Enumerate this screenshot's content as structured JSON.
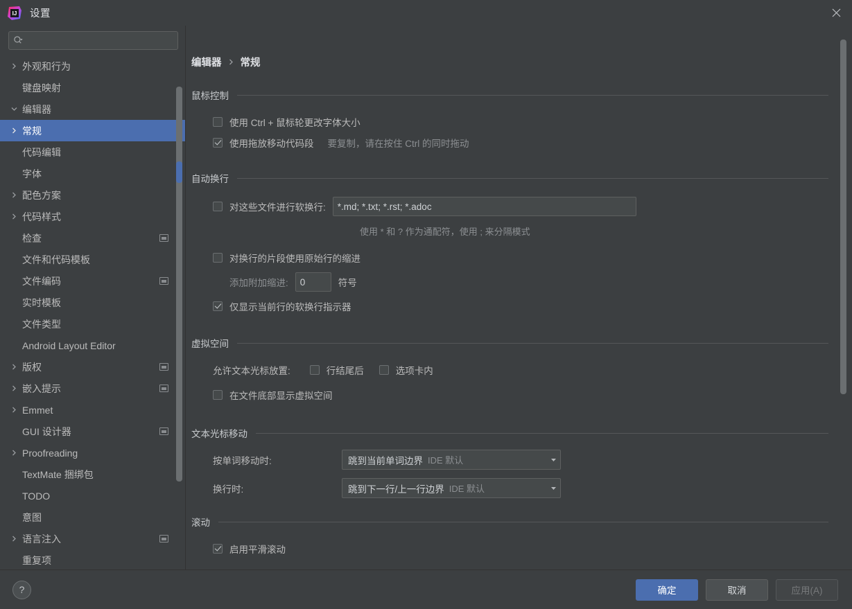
{
  "window": {
    "title": "设置",
    "app_icon": "intellij-idea-logo",
    "close_icon": "close-icon"
  },
  "sidebar": {
    "search": {
      "placeholder": "",
      "value": "",
      "icon": "search-icon"
    },
    "items": [
      {
        "label": "外观和行为",
        "level": 0,
        "arrow": "chevron-right",
        "badge": false,
        "selected": false
      },
      {
        "label": "键盘映射",
        "level": 0,
        "arrow": "",
        "badge": false,
        "selected": false
      },
      {
        "label": "编辑器",
        "level": 0,
        "arrow": "chevron-down",
        "badge": false,
        "selected": false
      },
      {
        "label": "常规",
        "level": 1,
        "arrow": "chevron-right",
        "badge": false,
        "selected": true
      },
      {
        "label": "代码编辑",
        "level": 1,
        "arrow": "",
        "badge": false,
        "selected": false
      },
      {
        "label": "字体",
        "level": 1,
        "arrow": "",
        "badge": false,
        "selected": false
      },
      {
        "label": "配色方案",
        "level": 1,
        "arrow": "chevron-right",
        "badge": false,
        "selected": false
      },
      {
        "label": "代码样式",
        "level": 1,
        "arrow": "chevron-right",
        "badge": false,
        "selected": false
      },
      {
        "label": "检查",
        "level": 1,
        "arrow": "",
        "badge": true,
        "selected": false
      },
      {
        "label": "文件和代码模板",
        "level": 1,
        "arrow": "",
        "badge": false,
        "selected": false
      },
      {
        "label": "文件编码",
        "level": 1,
        "arrow": "",
        "badge": true,
        "selected": false
      },
      {
        "label": "实时模板",
        "level": 1,
        "arrow": "",
        "badge": false,
        "selected": false
      },
      {
        "label": "文件类型",
        "level": 1,
        "arrow": "",
        "badge": false,
        "selected": false
      },
      {
        "label": "Android Layout Editor",
        "level": 1,
        "arrow": "",
        "badge": false,
        "selected": false
      },
      {
        "label": "版权",
        "level": 1,
        "arrow": "chevron-right",
        "badge": true,
        "selected": false
      },
      {
        "label": "嵌入提示",
        "level": 1,
        "arrow": "chevron-right",
        "badge": true,
        "selected": false
      },
      {
        "label": "Emmet",
        "level": 1,
        "arrow": "chevron-right",
        "badge": false,
        "selected": false
      },
      {
        "label": "GUI 设计器",
        "level": 1,
        "arrow": "",
        "badge": true,
        "selected": false
      },
      {
        "label": "Proofreading",
        "level": 1,
        "arrow": "chevron-right",
        "badge": false,
        "selected": false
      },
      {
        "label": "TextMate 捆绑包",
        "level": 1,
        "arrow": "",
        "badge": false,
        "selected": false
      },
      {
        "label": "TODO",
        "level": 1,
        "arrow": "",
        "badge": false,
        "selected": false
      },
      {
        "label": "意图",
        "level": 1,
        "arrow": "",
        "badge": false,
        "selected": false
      },
      {
        "label": "语言注入",
        "level": 1,
        "arrow": "chevron-right",
        "badge": true,
        "selected": false
      },
      {
        "label": "重复项",
        "level": 1,
        "arrow": "",
        "badge": false,
        "selected": false
      }
    ]
  },
  "breadcrumb": {
    "parent": "编辑器",
    "current": "常规",
    "separator_icon": "chevron-right-icon"
  },
  "sections": {
    "mouse": {
      "title": "鼠标控制",
      "ctrl_wheel": {
        "label": "使用 Ctrl + 鼠标轮更改字体大小",
        "checked": false
      },
      "drag_drop": {
        "label": "使用拖放移动代码段",
        "hint": "要复制，请在按住 Ctrl 的同时拖动",
        "checked": true
      }
    },
    "soft_wrap": {
      "title": "自动换行",
      "files_label": "对这些文件进行软换行:",
      "files_checked": false,
      "files_value": "*.md; *.txt; *.rst; *.adoc",
      "hint": "使用 * 和 ? 作为通配符，使用 ; 来分隔模式",
      "original_indent": {
        "label": "对换行的片段使用原始行的缩进",
        "checked": false
      },
      "additional_indent_label": "添加附加缩进:",
      "additional_indent_value": "0",
      "additional_indent_unit": "符号",
      "current_line_only": {
        "label": "仅显示当前行的软换行指示器",
        "checked": true
      }
    },
    "virtual_space": {
      "title": "虚拟空间",
      "allow_label": "允许文本光标放置:",
      "after_line_end": {
        "label": "行结尾后",
        "checked": false
      },
      "inside_tabs": {
        "label": "选项卡内",
        "checked": false
      },
      "show_bottom": {
        "label": "在文件底部显示虚拟空间",
        "checked": false
      }
    },
    "caret": {
      "title": "文本光标移动",
      "word_move_label": "按单词移动时:",
      "word_move_value": "跳到当前单词边界",
      "word_move_default": "IDE 默认",
      "line_wrap_label": "换行时:",
      "line_wrap_value": "跳到下一行/上一行边界",
      "line_wrap_default": "IDE 默认",
      "dropdown_icon": "chevron-down-icon"
    },
    "scrolling": {
      "title": "滚动",
      "smooth": {
        "label": "启用平滑滚动",
        "checked": true
      }
    }
  },
  "footer": {
    "help_label": "?",
    "ok": "确定",
    "cancel": "取消",
    "apply": "应用(A)"
  },
  "colors": {
    "background": "#3c3f41",
    "accent": "#4b6eaf",
    "text": "#bbbbbb",
    "text_bright": "#dfe1e5",
    "text_dim": "#8c8f92",
    "field_bg": "#45494a",
    "border": "#5e6060"
  }
}
